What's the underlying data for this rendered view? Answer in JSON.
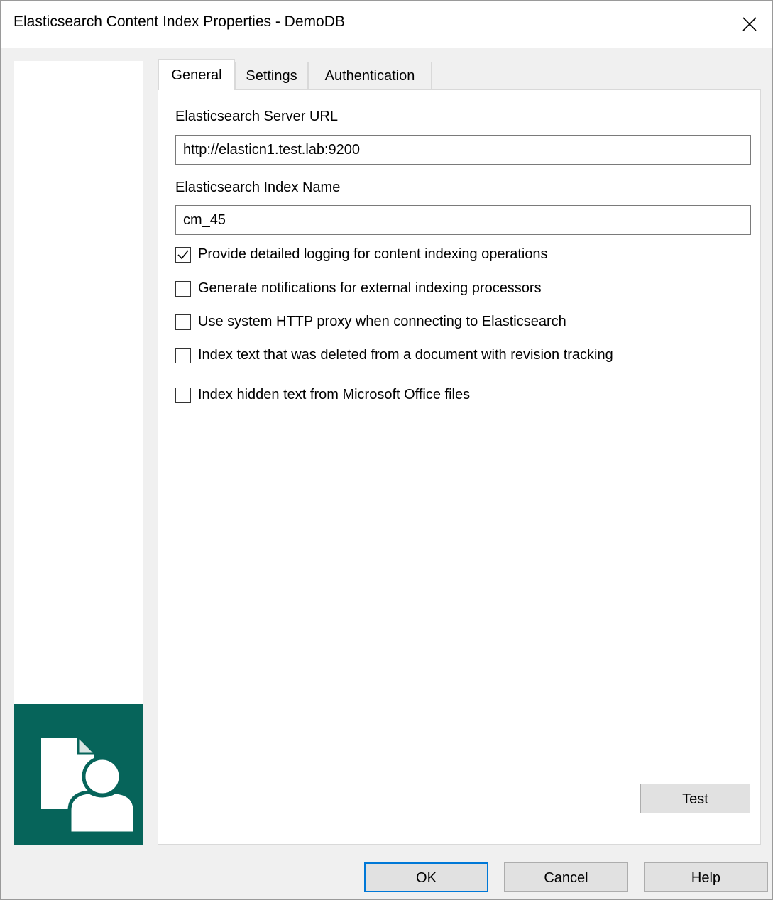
{
  "window": {
    "title": "Elasticsearch Content Index Properties - DemoDB",
    "close_icon": "close-icon"
  },
  "logo": {
    "icon": "document-user-icon",
    "color": "#06645a"
  },
  "tabs": [
    {
      "label": "General",
      "active": true
    },
    {
      "label": "Settings",
      "active": false
    },
    {
      "label": "Authentication",
      "active": false
    }
  ],
  "general": {
    "server_url_label": "Elasticsearch Server URL",
    "server_url_value": "http://elasticn1.test.lab:9200",
    "index_name_label": "Elasticsearch Index Name",
    "index_name_value": "cm_45",
    "options": [
      {
        "label": "Provide detailed logging for content indexing operations",
        "checked": true
      },
      {
        "label": "Generate notifications for external indexing processors",
        "checked": false
      },
      {
        "label": "Use system HTTP proxy when connecting to Elasticsearch",
        "checked": false
      },
      {
        "label": "Index text that was deleted from a document with revision tracking",
        "checked": false
      },
      {
        "label": "Index hidden text from Microsoft Office files",
        "checked": false
      }
    ],
    "test_label": "Test"
  },
  "footer": {
    "ok_label": "OK",
    "cancel_label": "Cancel",
    "help_label": "Help",
    "focus_color": "#0078d7"
  }
}
